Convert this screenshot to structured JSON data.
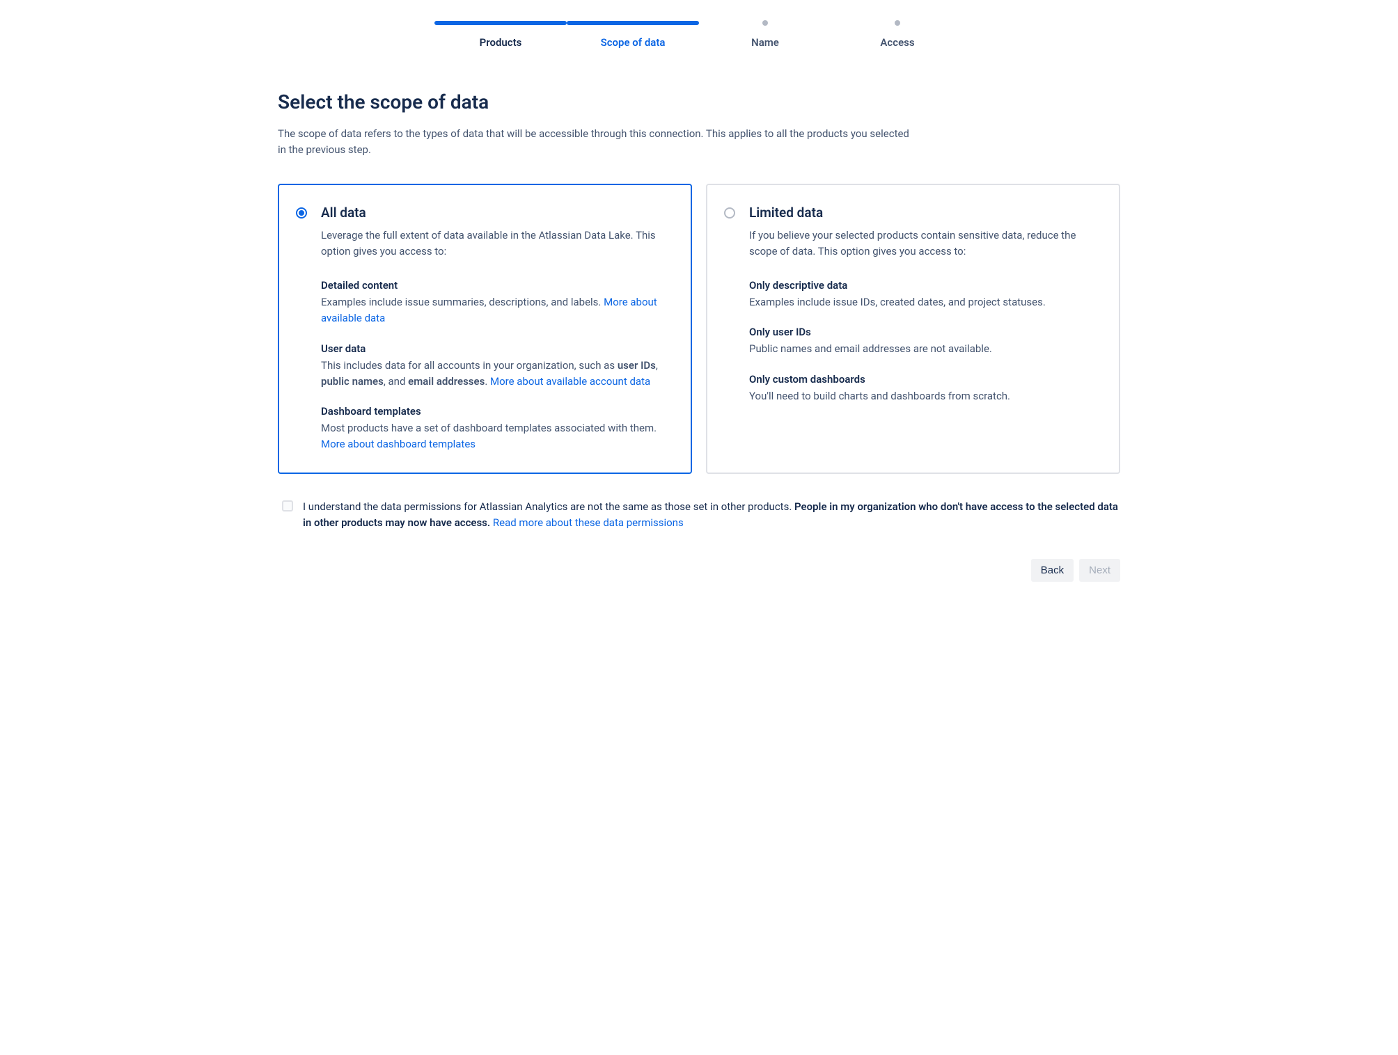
{
  "stepper": {
    "steps": [
      {
        "label": "Products",
        "state": "complete"
      },
      {
        "label": "Scope of data",
        "state": "active"
      },
      {
        "label": "Name",
        "state": "pending"
      },
      {
        "label": "Access",
        "state": "pending"
      }
    ]
  },
  "heading": {
    "title": "Select the scope of data",
    "description": "The scope of data refers to the types of data that will be accessible through this connection. This applies to all the products you selected in the previous step."
  },
  "options": {
    "all": {
      "title": "All data",
      "intro": "Leverage the full extent of data available in the Atlassian Data Lake. This option gives you access to:",
      "sections": {
        "detailed": {
          "title": "Detailed content",
          "text": "Examples include issue summaries, descriptions, and labels. ",
          "link": "More about available data"
        },
        "user": {
          "title": "User data",
          "text_prefix": "This includes data for all accounts in your organization, such as ",
          "bold1": "user IDs",
          "sep1": ", ",
          "bold2": "public names",
          "sep2": ", and ",
          "bold3": "email addresses",
          "suffix": ". ",
          "link": "More about available account data"
        },
        "dashboards": {
          "title": "Dashboard templates",
          "text": "Most products have a set of dashboard templates associated with them. ",
          "link": "More about dashboard templates"
        }
      }
    },
    "limited": {
      "title": "Limited data",
      "intro": "If you believe your selected products contain sensitive data, reduce the scope of data. This option gives you access to:",
      "sections": {
        "descriptive": {
          "title": "Only descriptive data",
          "text": "Examples include issue IDs, created dates, and project statuses."
        },
        "userids": {
          "title": "Only user IDs",
          "text": "Public names and email addresses are not available."
        },
        "custom": {
          "title": "Only custom dashboards",
          "text": "You'll need to build charts and dashboards from scratch."
        }
      }
    }
  },
  "consent": {
    "text_prefix": "I understand the data permissions for Atlassian Analytics are not the same as those set in other products. ",
    "bold": "People in my organization who don't have access to the selected data in other products may now have access.",
    "space": " ",
    "link": "Read more about these data permissions"
  },
  "footer": {
    "back": "Back",
    "next": "Next"
  }
}
